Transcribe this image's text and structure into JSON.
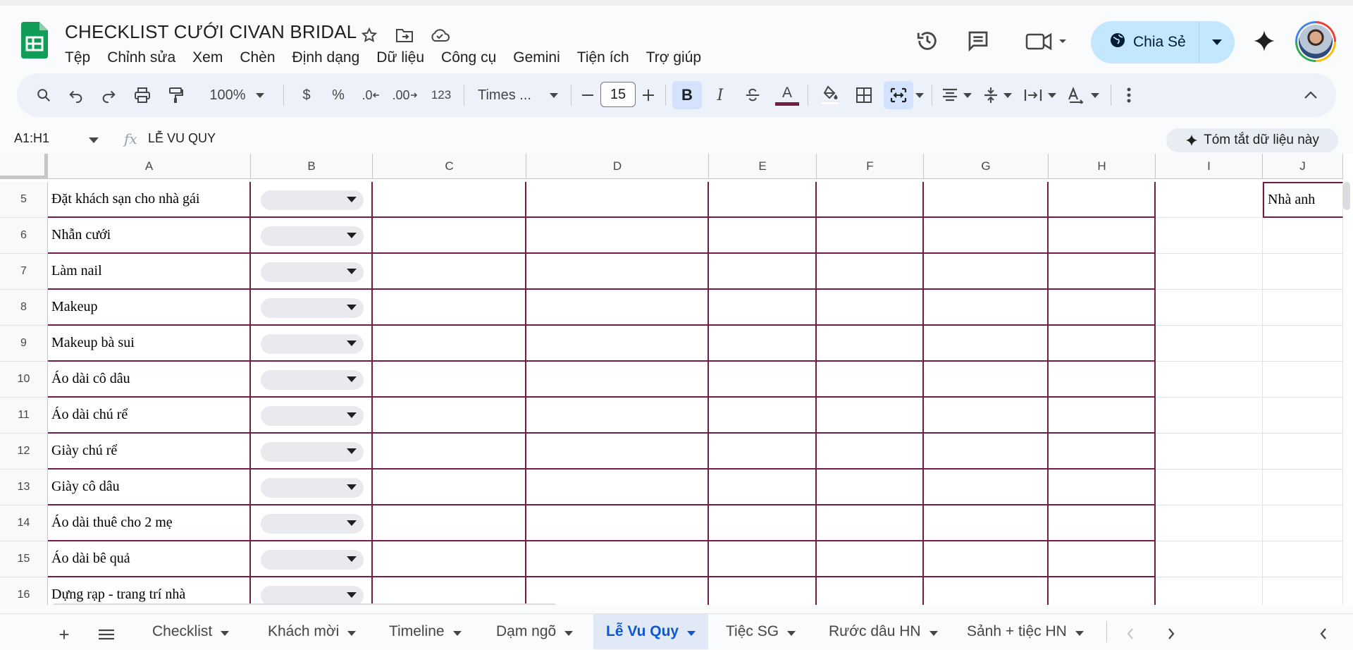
{
  "document": {
    "title": "CHECKLIST CƯỚI CIVAN BRIDAL",
    "menus": [
      "Tệp",
      "Chỉnh sửa",
      "Xem",
      "Chèn",
      "Định dạng",
      "Dữ liệu",
      "Công cụ",
      "Gemini",
      "Tiện ích",
      "Trợ giúp"
    ],
    "share_label": "Chia Sẻ"
  },
  "toolbar": {
    "zoom": "100%",
    "currency": "$",
    "percent": "%",
    "dec_decrease": ".0",
    "dec_increase": ".00",
    "format_123": "123",
    "font": "Times ...",
    "font_size": "15",
    "bold": "B",
    "italic": "I",
    "text_color": "A",
    "text_color_value": "#741b47"
  },
  "formula_bar": {
    "name_box": "A1:H1",
    "fx": "fx",
    "formula": "LỄ VU QUY",
    "summarize": "Tóm tắt dữ liệu này"
  },
  "grid": {
    "columns": [
      "A",
      "B",
      "C",
      "D",
      "E",
      "F",
      "G",
      "H",
      "I",
      "J"
    ],
    "rows": [
      {
        "num": "5",
        "a": "Đặt khách sạn cho nhà gái"
      },
      {
        "num": "6",
        "a": "Nhẫn cưới"
      },
      {
        "num": "7",
        "a": "Làm nail"
      },
      {
        "num": "8",
        "a": "Makeup"
      },
      {
        "num": "9",
        "a": "Makeup bà sui"
      },
      {
        "num": "10",
        "a": "Áo dài cô dâu"
      },
      {
        "num": "11",
        "a": "Áo dài chú rể"
      },
      {
        "num": "12",
        "a": "Giày chú rể"
      },
      {
        "num": "13",
        "a": "Giày cô dâu"
      },
      {
        "num": "14",
        "a": "Áo dài thuê cho 2 mẹ"
      },
      {
        "num": "15",
        "a": "Áo dài bê quả"
      },
      {
        "num": "16",
        "a": "Dựng rạp - trang trí nhà"
      }
    ],
    "j5": "Nhà anh",
    "border_color": "#741b47"
  },
  "sheets": {
    "tabs": [
      "Checklist",
      "Khách mời",
      "Timeline",
      "Dạm ngõ",
      "Lễ Vu Quy",
      "Tiệc SG",
      "Rước dâu HN",
      "Sảnh + tiệc HN"
    ],
    "active": "Lễ Vu Quy",
    "add": "+",
    "all_sheets": "≡"
  }
}
